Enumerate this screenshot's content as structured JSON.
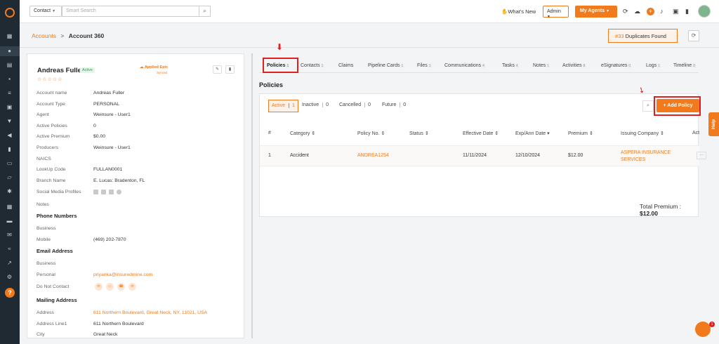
{
  "topbar": {
    "search_type": "Contact",
    "search_placeholder": "Smart Search",
    "whats_new": "What's New",
    "role": "Admin",
    "my_agents": "My Agents"
  },
  "breadcrumb": {
    "parent": "Accounts",
    "separator": ">",
    "current": "Account 360"
  },
  "duplicates": {
    "count": "#33",
    "label": "Duplicates Found"
  },
  "account": {
    "name": "Andreas Fuller",
    "status": "Active",
    "integration": "Applied Epic",
    "integration_sub": "Synced",
    "stars": "☆☆☆☆☆",
    "fields": [
      {
        "label": "Account name",
        "value": "Andreas Fuller"
      },
      {
        "label": "Account Type",
        "value": "PERSONAL"
      },
      {
        "label": "Agent",
        "value": "Weinsure - User1"
      },
      {
        "label": "Active Policies",
        "value": "0"
      },
      {
        "label": "Active Premium",
        "value": "$0.00"
      },
      {
        "label": "Producers",
        "value": "Weinsure - User1"
      },
      {
        "label": "NAICS",
        "value": ""
      },
      {
        "label": "LookUp Code",
        "value": "FULLAN0001"
      },
      {
        "label": "Branch Name",
        "value": "E. Lucas: Bradenton, FL"
      },
      {
        "label": "Social Media Profiles",
        "value": ""
      },
      {
        "label": "Notes",
        "value": ""
      }
    ],
    "phone_heading": "Phone Numbers",
    "phone": [
      {
        "label": "Business",
        "value": ""
      },
      {
        "label": "Mobile",
        "value": "(469) 202-7870"
      }
    ],
    "email_heading": "Email Address",
    "email": [
      {
        "label": "Business",
        "value": ""
      },
      {
        "label": "Personal",
        "value": "priyanka@insuredmine.com"
      },
      {
        "label": "Do Not Contact",
        "value": ""
      }
    ],
    "mailing_heading": "Mailing Address",
    "mailing": [
      {
        "label": "Address",
        "value": "611 Northern Boulevard, Great Neck, NY, 11021, USA"
      },
      {
        "label": "Address Line1",
        "value": "611 Northern Boulevard"
      },
      {
        "label": "City",
        "value": "Great Neck"
      }
    ]
  },
  "tabs": [
    {
      "label": "Policies",
      "count": "1"
    },
    {
      "label": "Contacts",
      "count": "1"
    },
    {
      "label": "Claims",
      "count": ""
    },
    {
      "label": "Pipeline Cards",
      "count": "1"
    },
    {
      "label": "Files",
      "count": "1"
    },
    {
      "label": "Communications",
      "count": "4"
    },
    {
      "label": "Tasks",
      "count": "4"
    },
    {
      "label": "Notes",
      "count": "1"
    },
    {
      "label": "Activities",
      "count": "8"
    },
    {
      "label": "eSignatures",
      "count": "0"
    },
    {
      "label": "Logs",
      "count": "1"
    },
    {
      "label": "Timeline",
      "count": "0"
    }
  ],
  "policies": {
    "title": "Policies",
    "filters": [
      {
        "label": "Active",
        "count": "1"
      },
      {
        "label": "Inactive",
        "count": "0"
      },
      {
        "label": "Cancelled",
        "count": "0"
      },
      {
        "label": "Future",
        "count": "0"
      }
    ],
    "add_label": "+ Add Policy",
    "columns": [
      "#",
      "Category",
      "Policy No.",
      "Status",
      "Effective Date",
      "Exp/Ann Date",
      "Premium",
      "Issuing Company",
      "Action"
    ],
    "rows": [
      {
        "num": "1",
        "category": "Accident",
        "policy_no": "ANDREA1254",
        "status": "",
        "effective": "11/11/2024",
        "expiry": "12/10/2024",
        "premium": "$12.00",
        "company": "ASPERA INSURANCE SERVICES"
      }
    ],
    "total_label": "Total Premium :",
    "total_value": "$12.00"
  },
  "help_label": "Help",
  "chat_count": "1"
}
